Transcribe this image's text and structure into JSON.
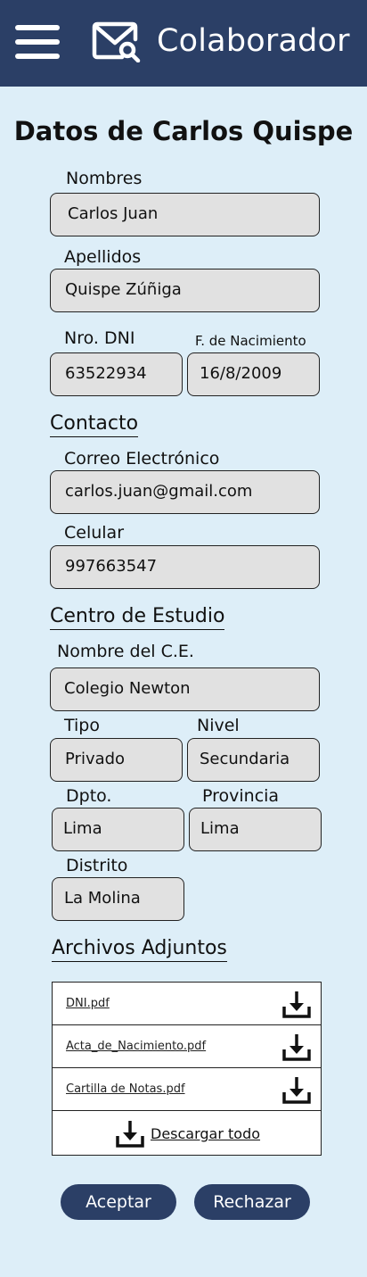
{
  "header": {
    "title": "Colaborador",
    "menu_icon": "hamburger-menu-icon",
    "mail_icon": "mail-search-icon",
    "background": "#2b3f66"
  },
  "page": {
    "title": "Datos de Carlos Quispe",
    "background": "#ddeef8"
  },
  "personal": {
    "nombres_label": "Nombres",
    "nombres_value": "Carlos Juan",
    "apellidos_label": "Apellidos",
    "apellidos_value": "Quispe Zúñiga",
    "dni_label": "Nro. DNI",
    "dni_value": "63522934",
    "nacimiento_label": "F. de Nacimiento",
    "nacimiento_value": "16/8/2009"
  },
  "contacto": {
    "section_title": "Contacto",
    "correo_label": "Correo Electrónico",
    "correo_value": "carlos.juan@gmail.com",
    "celular_label": "Celular",
    "celular_value": "997663547"
  },
  "centro": {
    "section_title": "Centro de Estudio",
    "nombre_label": "Nombre del C.E.",
    "nombre_value": "Colegio Newton",
    "tipo_label": "Tipo",
    "tipo_value": "Privado",
    "nivel_label": "Nivel",
    "nivel_value": "Secundaria",
    "dpto_label": "Dpto.",
    "dpto_value": "Lima",
    "provincia_label": "Provincia",
    "provincia_value": "Lima",
    "distrito_label": "Distrito",
    "distrito_value": "La Molina"
  },
  "archivos": {
    "section_title": "Archivos Adjuntos",
    "files": [
      {
        "name": "DNI.pdf",
        "icon": "download-icon"
      },
      {
        "name": "Acta_de_Nacimiento.pdf",
        "icon": "download-icon"
      },
      {
        "name": "Cartilla de Notas.pdf",
        "icon": "download-icon"
      }
    ],
    "download_all_label": "Descargar todo"
  },
  "actions": {
    "accept_label": "Aceptar",
    "reject_label": "Rechazar",
    "button_color": "#2b3f66"
  }
}
